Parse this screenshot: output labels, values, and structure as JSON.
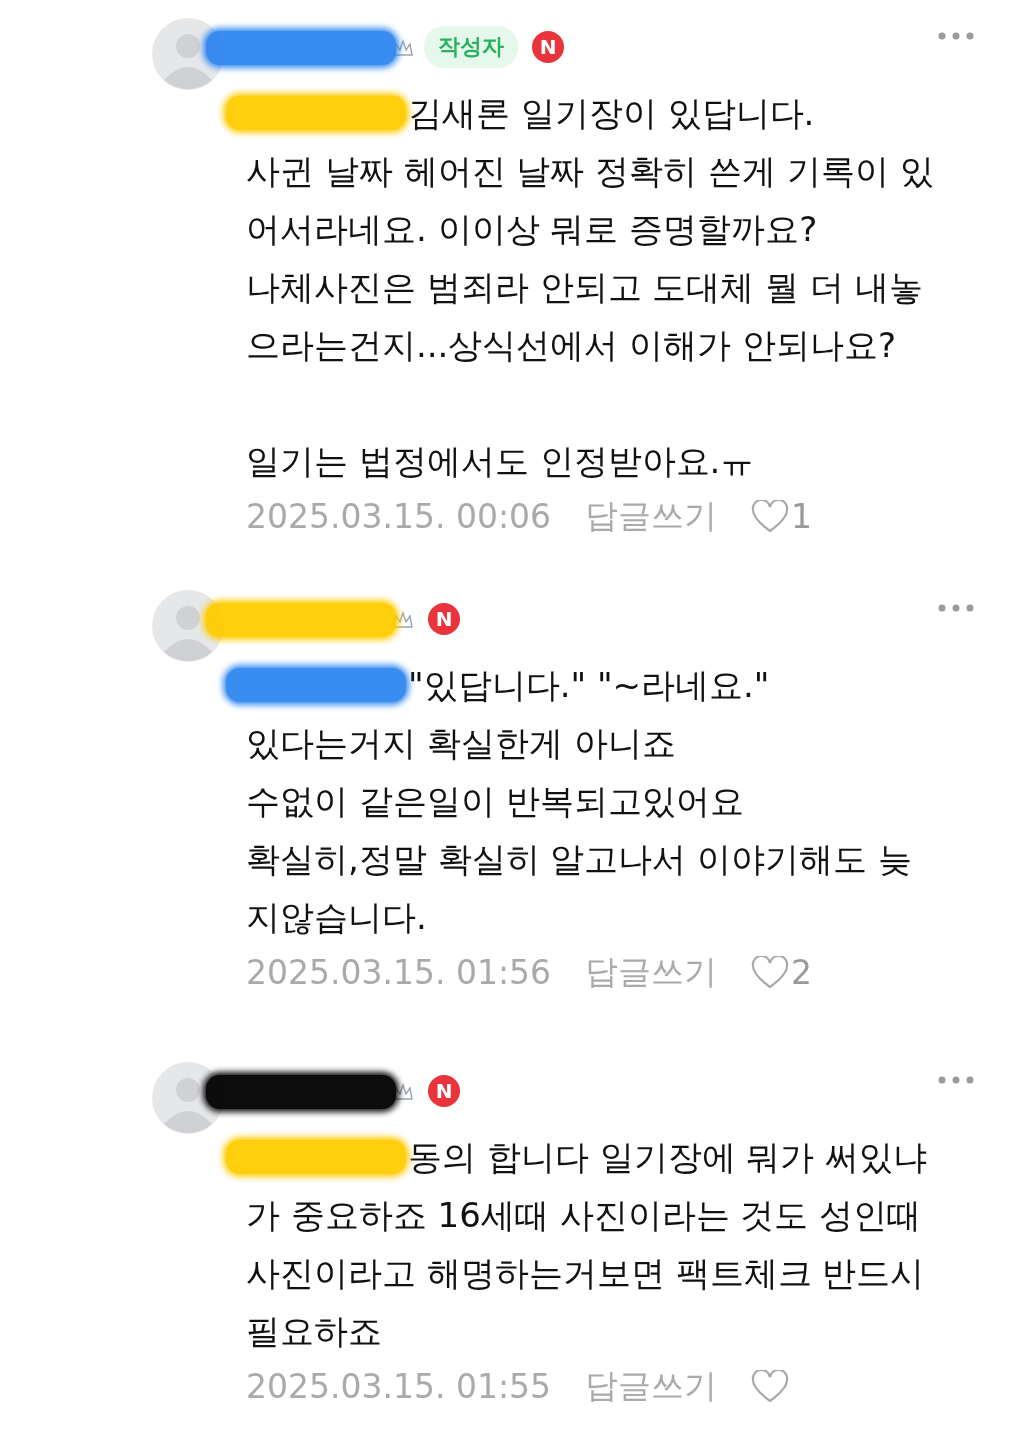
{
  "comments": [
    {
      "name_mark": {
        "color": "#2f86f0"
      },
      "author_badge": "작성자",
      "new_badge": "N",
      "mention_mark": {
        "color": "#ffcc00"
      },
      "paragraphs": [
        [
          "김새론 일기장이 있답니다.",
          "사귄 날짜 헤어진 날짜 정확히 쓴게 기록이 있",
          "어서라네요. 이이상 뭐로 증명할까요?",
          "나체사진은 범죄라 안되고 도대체 뭘 더 내놓",
          "으라는건지...상식선에서 이해가 안되나요?"
        ],
        [
          "일기는 법정에서도 인정받아요.ㅠ"
        ]
      ],
      "date": "2025.03.15. 00:06",
      "reply": "답글쓰기",
      "liked": false,
      "likes": "1"
    },
    {
      "name_mark": {
        "color": "#ffcc00"
      },
      "new_badge": "N",
      "mention_mark": {
        "color": "#2f86f0"
      },
      "paragraphs": [
        [
          "\"있답니다.\" \"~라네요.\"",
          "있다는거지 확실한게 아니죠",
          "수없이 같은일이 반복되고있어요",
          "확실히,정말 확실히 알고나서 이야기해도 늦",
          "지않습니다."
        ]
      ],
      "date": "2025.03.15. 01:56",
      "reply": "답글쓰기",
      "liked": false,
      "likes": "2"
    },
    {
      "name_mark": {
        "color": "#000000"
      },
      "new_badge": "N",
      "mention_mark": {
        "color": "#ffcc00"
      },
      "paragraphs": [
        [
          "동의 합니다 일기장에 뭐가 써있냐",
          "가 중요하죠 16세때 사진이라는 것도 성인때",
          "사진이라고 해명하는거보면 팩트체크 반드시",
          "필요하죠"
        ]
      ],
      "date": "2025.03.15. 01:55",
      "reply": "답글쓰기",
      "liked": false
    }
  ]
}
